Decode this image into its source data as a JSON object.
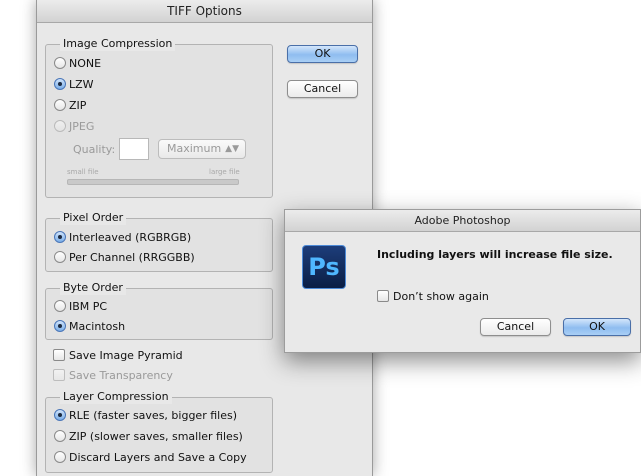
{
  "tiff_dialog": {
    "title": "TIFF Options",
    "image_compression": {
      "legend": "Image Compression",
      "options": [
        {
          "label": "NONE",
          "selected": false,
          "disabled": false
        },
        {
          "label": "LZW",
          "selected": true,
          "disabled": false
        },
        {
          "label": "ZIP",
          "selected": false,
          "disabled": false
        },
        {
          "label": "JPEG",
          "selected": false,
          "disabled": true
        }
      ],
      "quality_label": "Quality:",
      "quality_value": "",
      "quality_select": "Maximum",
      "small_file_label": "small file",
      "large_file_label": "large file"
    },
    "ok_label": "OK",
    "cancel_label": "Cancel",
    "pixel_order": {
      "legend": "Pixel Order",
      "options": [
        {
          "label": "Interleaved (RGBRGB)",
          "selected": true
        },
        {
          "label": "Per Channel (RRGGBB)",
          "selected": false
        }
      ]
    },
    "byte_order": {
      "legend": "Byte Order",
      "options": [
        {
          "label": "IBM PC",
          "selected": false
        },
        {
          "label": "Macintosh",
          "selected": true
        }
      ]
    },
    "save_image_pyramid": {
      "label": "Save Image Pyramid",
      "checked": false,
      "disabled": false
    },
    "save_transparency": {
      "label": "Save Transparency",
      "checked": false,
      "disabled": true
    },
    "layer_compression": {
      "legend": "Layer Compression",
      "options": [
        {
          "label": "RLE (faster saves, bigger files)",
          "selected": true
        },
        {
          "label": "ZIP (slower saves, smaller files)",
          "selected": false
        },
        {
          "label": "Discard Layers and Save a Copy",
          "selected": false
        }
      ]
    }
  },
  "alert": {
    "title": "Adobe Photoshop",
    "icon": "photoshop-icon",
    "icon_text": "Ps",
    "message": "Including layers will increase file size.",
    "dont_show_label": "Don’t show again",
    "dont_show_checked": false,
    "cancel_label": "Cancel",
    "ok_label": "OK"
  },
  "colors": {
    "default_button": "#8fbdf0",
    "selected_radio": "#7aaee8",
    "ps_icon_bg": "#0b1e44",
    "ps_icon_text": "#4fb7ff"
  }
}
